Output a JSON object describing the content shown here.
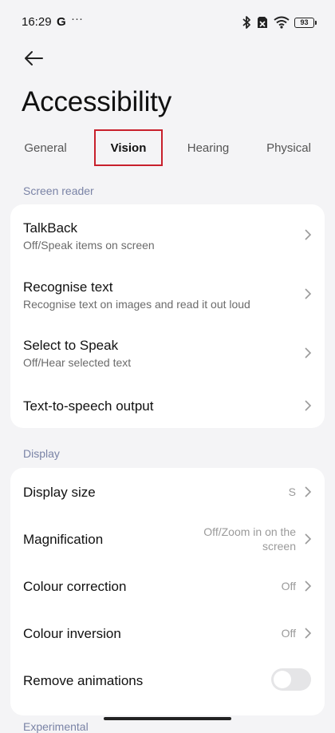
{
  "status": {
    "time": "16:29",
    "g": "G",
    "dots": "···",
    "battery": "93"
  },
  "title": "Accessibility",
  "tabs": [
    "General",
    "Vision",
    "Hearing",
    "Physical"
  ],
  "screen_reader": {
    "header": "Screen reader",
    "items": [
      {
        "title": "TalkBack",
        "subtitle": "Off/Speak items on screen"
      },
      {
        "title": "Recognise text",
        "subtitle": "Recognise text on images and read it out loud"
      },
      {
        "title": "Select to Speak",
        "subtitle": "Off/Hear selected text"
      },
      {
        "title": "Text-to-speech output"
      }
    ]
  },
  "display": {
    "header": "Display",
    "items": [
      {
        "title": "Display size",
        "value": "S"
      },
      {
        "title": "Magnification",
        "value_line1": "Off/Zoom in on the",
        "value_line2": "screen"
      },
      {
        "title": "Colour correction",
        "value": "Off"
      },
      {
        "title": "Colour inversion",
        "value": "Off"
      },
      {
        "title": "Remove animations",
        "toggle_on": false
      }
    ]
  },
  "next_section": "Experimental"
}
